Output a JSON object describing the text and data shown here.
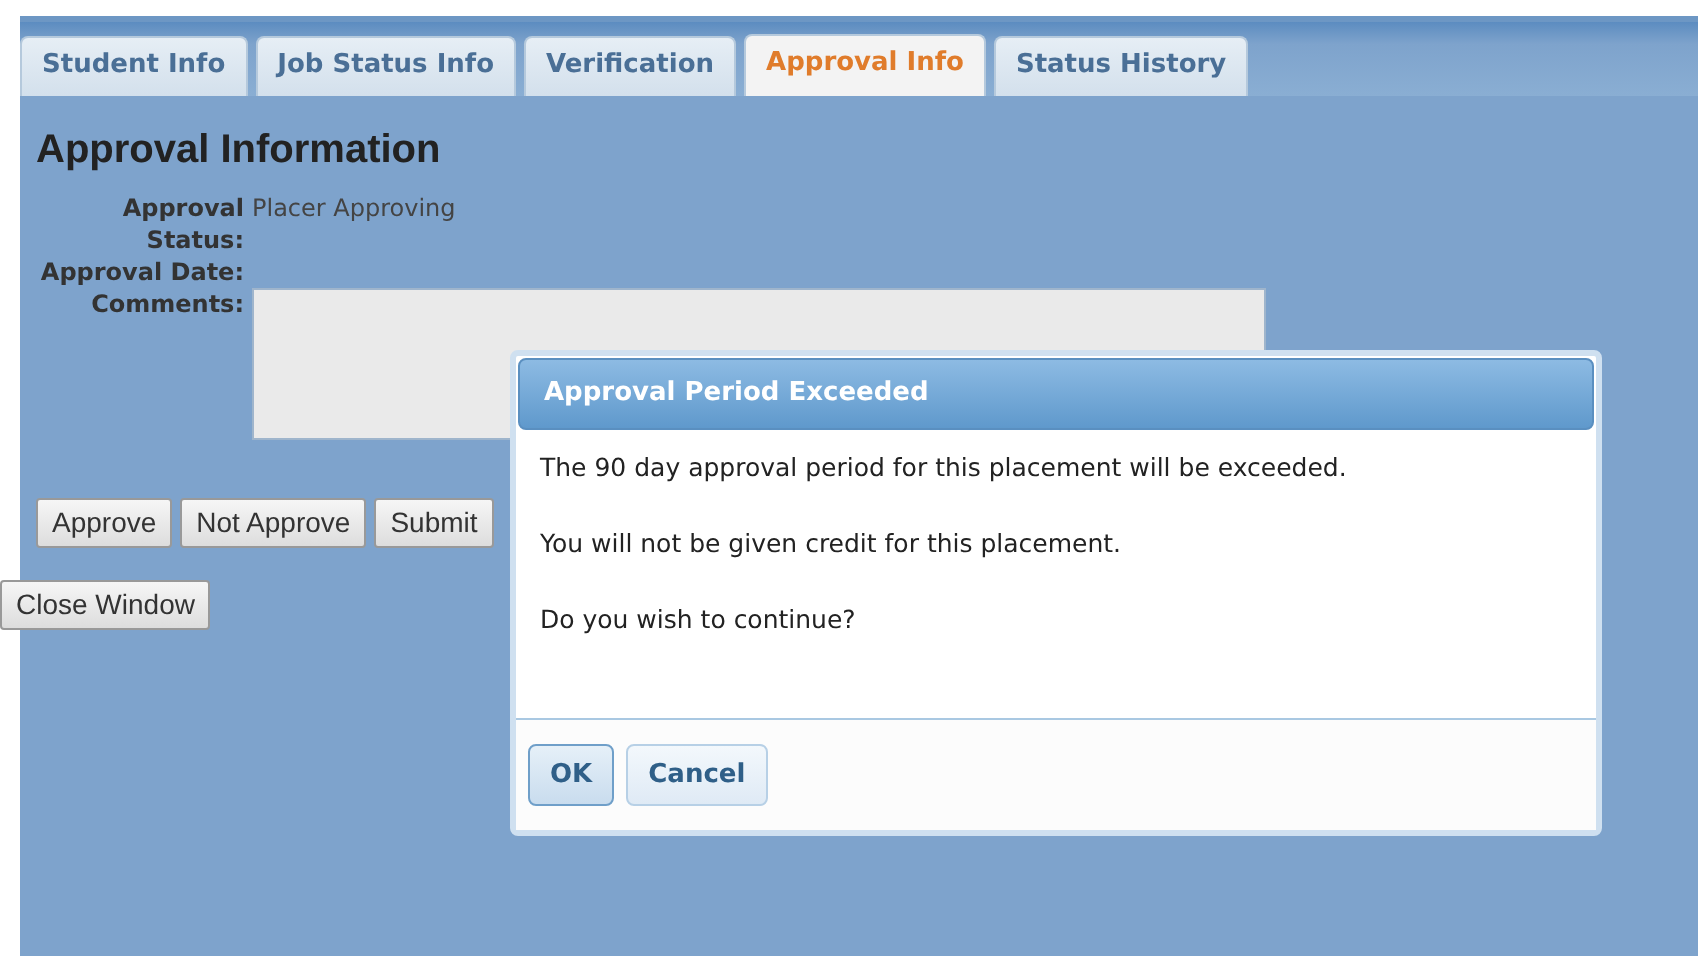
{
  "tabs": [
    {
      "label": "Student Info",
      "selected": false
    },
    {
      "label": "Job Status Info",
      "selected": false
    },
    {
      "label": "Verification",
      "selected": false
    },
    {
      "label": "Approval Info",
      "selected": true
    },
    {
      "label": "Status History",
      "selected": false
    }
  ],
  "heading": "Approval Information",
  "fields": [
    {
      "label": "Approval Status:",
      "value": "Placer Approving"
    },
    {
      "label": "Approval Date:"
    }
  ],
  "comments": {
    "label": "Comments:"
  },
  "buttons": [
    "Approve",
    "Not Approve",
    "Submit"
  ],
  "close_button": "Close Window",
  "dialog": {
    "title": "Approval Period Exceeded",
    "messages": [
      "The 90 day approval period for this placement will be exceeded.",
      "You will not be given credit for this placement.",
      "Do you wish to continue?"
    ],
    "buttons": [
      {
        "label": "OK",
        "selected": true
      },
      {
        "label": "Cancel",
        "selected": false
      }
    ]
  }
}
